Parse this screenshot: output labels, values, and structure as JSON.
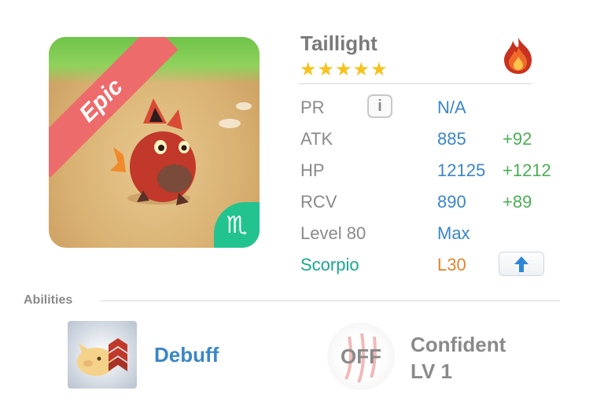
{
  "monster": {
    "name": "Taillight",
    "stars": "★★★★★",
    "rarity": "Epic",
    "element_icon": "fire-icon",
    "sign_glyph": "♏"
  },
  "stats": [
    {
      "label": "PR",
      "value": "N/A",
      "bonus": ""
    },
    {
      "label": "ATK",
      "value": "885",
      "bonus": "+92"
    },
    {
      "label": "HP",
      "value": "12125",
      "bonus": "+1212"
    },
    {
      "label": "RCV",
      "value": "890",
      "bonus": "+89"
    },
    {
      "label": "Level 80",
      "value": "Max",
      "bonus": ""
    }
  ],
  "zodiac": {
    "label": "Scorpio",
    "level": "L30"
  },
  "abilities": {
    "section_label": "Abilities",
    "items": [
      {
        "name": "Debuff"
      },
      {
        "status": "OFF",
        "name": "Confident",
        "level": "LV 1"
      }
    ]
  },
  "colors": {
    "accent_blue": "#3a86c8",
    "bonus_green": "#4cae55",
    "scorpio_teal": "#1aa88a",
    "level_orange": "#e8822a",
    "epic_red": "#ee6b6b"
  }
}
